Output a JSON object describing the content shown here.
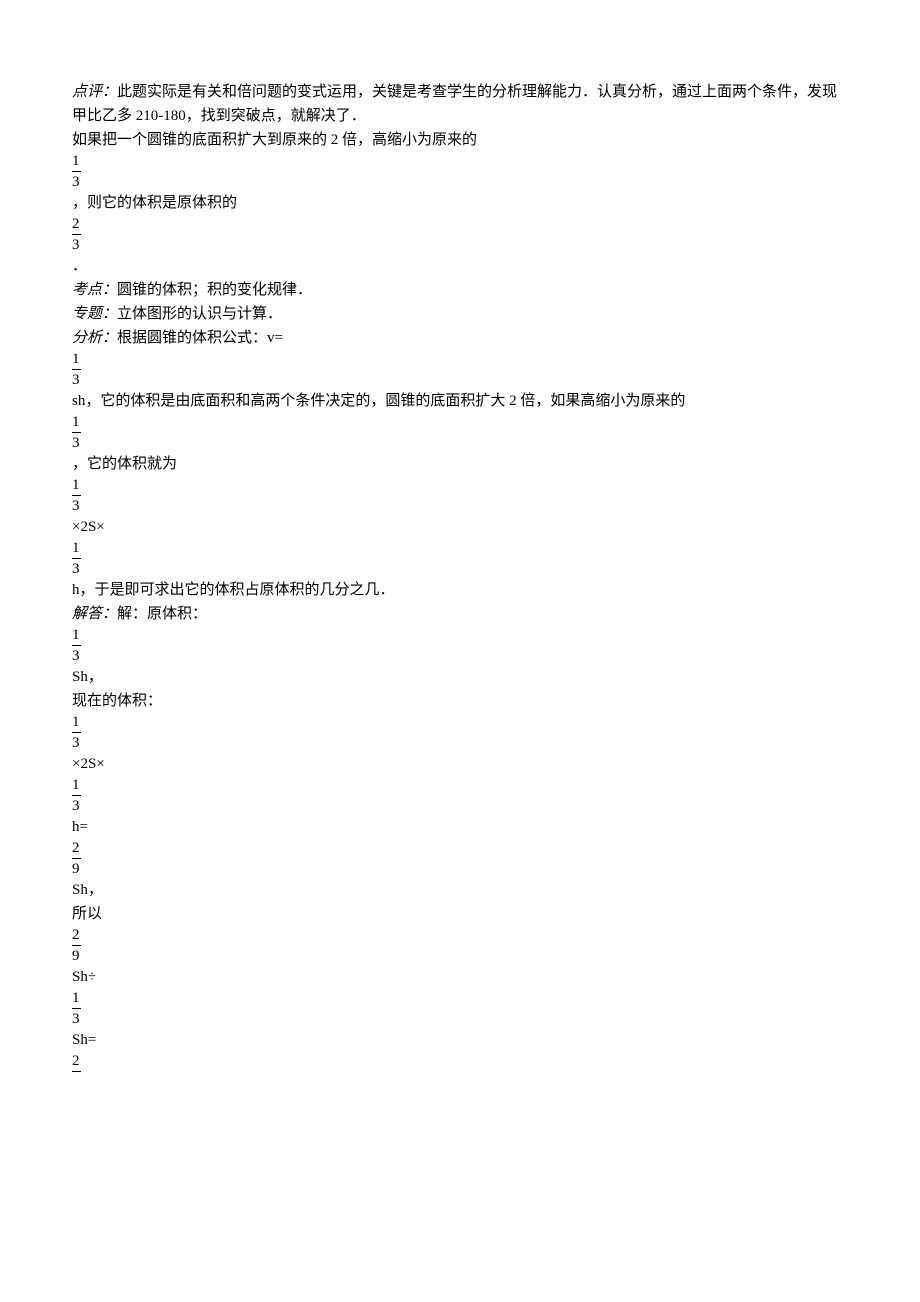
{
  "lines": [
    {
      "label": "点评：",
      "text": "此题实际是有关和倍问题的变式运用，关键是考查学生的分析理解能力．认真分析，通过上面两个条件，发现甲比乙多 210-180，找到突破点，就解决了．"
    },
    {
      "text": "如果把一个圆锥的底面积扩大到原来的 2 倍，高缩小为原来的"
    },
    {
      "frac": [
        "1",
        "3"
      ]
    },
    {
      "text": "，则它的体积是原体积的"
    },
    {
      "frac": [
        "2",
        "3"
      ]
    },
    {
      "text": "．"
    },
    {
      "label": "考点：",
      "text": "圆锥的体积；积的变化规律．"
    },
    {
      "label": "专题：",
      "text": "立体图形的认识与计算．"
    },
    {
      "label": "分析：",
      "text": "根据圆锥的体积公式：v="
    },
    {
      "frac": [
        "1",
        "3"
      ]
    },
    {
      "text": "sh，它的体积是由底面积和高两个条件决定的，圆锥的底面积扩大 2 倍，如果高缩小为原来的"
    },
    {
      "frac": [
        "1",
        "3"
      ]
    },
    {
      "text": "，它的体积就为"
    },
    {
      "frac": [
        "1",
        "3"
      ]
    },
    {
      "text": "×2S×"
    },
    {
      "frac": [
        "1",
        "3"
      ]
    },
    {
      "text": "h，于是即可求出它的体积占原体积的几分之几．"
    },
    {
      "label": "解答：",
      "text": "解：原体积："
    },
    {
      "frac": [
        "1",
        "3"
      ]
    },
    {
      "text": "Sh，"
    },
    {
      "text": "现在的体积："
    },
    {
      "frac": [
        "1",
        "3"
      ]
    },
    {
      "text": "×2S×"
    },
    {
      "frac": [
        "1",
        "3"
      ]
    },
    {
      "text": "h="
    },
    {
      "frac": [
        "2",
        "9"
      ]
    },
    {
      "text": "Sh，"
    },
    {
      "text": "所以"
    },
    {
      "frac": [
        "2",
        "9"
      ]
    },
    {
      "text": "Sh÷"
    },
    {
      "frac": [
        "1",
        "3"
      ]
    },
    {
      "text": "Sh="
    },
    {
      "frac_partial": "2"
    }
  ]
}
